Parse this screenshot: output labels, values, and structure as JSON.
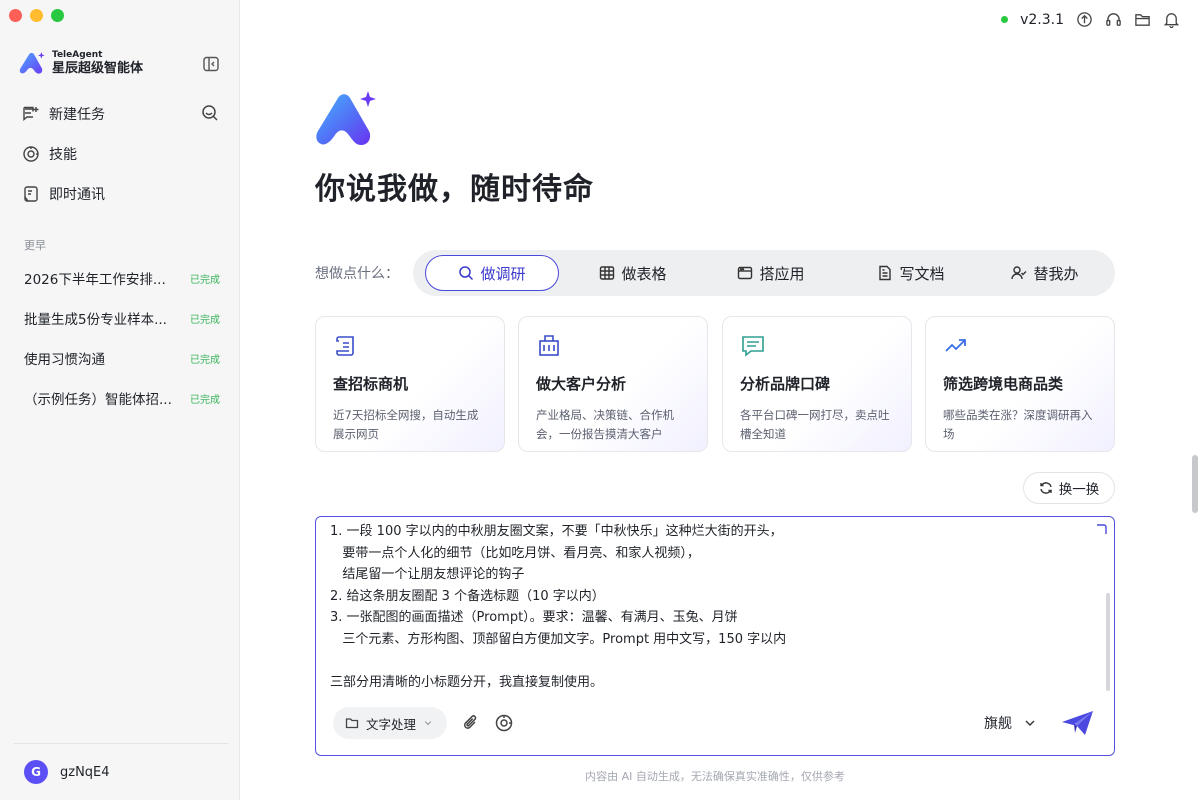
{
  "app": {
    "brand_en": "TeleAgent",
    "brand_cn": "星辰超级智能体",
    "version": "v2.3.1"
  },
  "sidebar": {
    "nav": [
      {
        "label": "新建任务",
        "icon": "new-task-icon"
      },
      {
        "label": "技能",
        "icon": "skills-icon"
      },
      {
        "label": "即时通讯",
        "icon": "im-icon"
      }
    ],
    "section_label": "更早",
    "tasks": [
      {
        "title": "2026下半年工作安排...",
        "status": "已完成"
      },
      {
        "title": "批量生成5份专业样本...",
        "status": "已完成"
      },
      {
        "title": "使用习惯沟通",
        "status": "已完成"
      },
      {
        "title": "（示例任务）智能体招...",
        "status": "已完成"
      }
    ],
    "user": {
      "initial": "G",
      "name": "gzNqE4"
    }
  },
  "main": {
    "title": "你说我做，随时待命",
    "mode_label": "想做点什么：",
    "modes": [
      {
        "label": "做调研",
        "icon": "search-icon",
        "active": true
      },
      {
        "label": "做表格",
        "icon": "table-icon",
        "active": false
      },
      {
        "label": "搭应用",
        "icon": "app-window-icon",
        "active": false
      },
      {
        "label": "写文档",
        "icon": "document-icon",
        "active": false
      },
      {
        "label": "替我办",
        "icon": "user-check-icon",
        "active": false
      }
    ],
    "cards": [
      {
        "title": "查招标商机",
        "desc": "近7天招标全网搜，自动生成展示网页",
        "icon": "scroll-icon"
      },
      {
        "title": "做大客户分析",
        "desc": "产业格局、决策链、合作机会，一份报告摸清大客户",
        "icon": "building-icon"
      },
      {
        "title": "分析品牌口碑",
        "desc": "各平台口碑一网打尽，卖点吐槽全知道",
        "icon": "message-icon"
      },
      {
        "title": "筛选跨境电商品类",
        "desc": "哪些品类在涨？深度调研再入场",
        "icon": "trending-up-icon"
      }
    ],
    "refresh_label": "换一换"
  },
  "composer": {
    "text": "1. 一段 100 字以内的中秋朋友圈文案，不要「中秋快乐」这种烂大街的开头，\n   要带一点个人化的细节（比如吃月饼、看月亮、和家人视频），\n   结尾留一个让朋友想评论的钩子\n2. 给这条朋友圈配 3 个备选标题（10 字以内）\n3. 一张配图的画面描述（Prompt）。要求：温馨、有满月、玉兔、月饼\n   三个元素、方形构图、顶部留白方便加文字。Prompt 用中文写，150 字以内\n\n三部分用清晰的小标题分开，我直接复制使用。",
    "tool_label": "文字处理",
    "model_label": "旗舰"
  },
  "disclaimer": "内容由 AI 自动生成，无法确保真实准确性，仅供参考",
  "colors": {
    "accent": "#4b49d9",
    "success": "#3bb45b",
    "avatar": "#5b4ff5"
  }
}
